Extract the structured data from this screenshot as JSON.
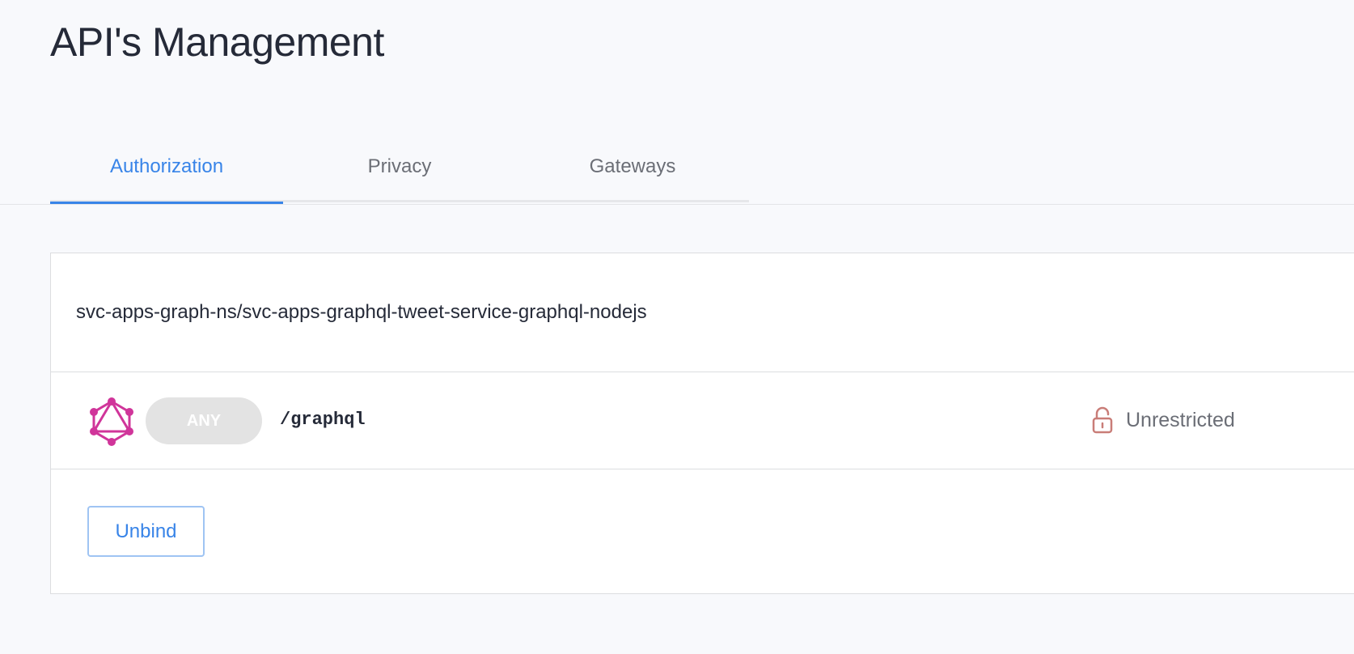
{
  "page": {
    "title": "API's Management"
  },
  "tabs": [
    {
      "label": "Authorization",
      "active": true
    },
    {
      "label": "Privacy",
      "active": false
    },
    {
      "label": "Gateways",
      "active": false
    }
  ],
  "service": {
    "name": "svc-apps-graph-ns/svc-apps-graphql-tweet-service-graphql-nodejs"
  },
  "route": {
    "icon": "graphql-icon",
    "method": "ANY",
    "path": "/graphql",
    "access_icon": "unlock-icon",
    "access_status": "Unrestricted"
  },
  "actions": {
    "unbind_label": "Unbind"
  },
  "colors": {
    "accent": "#3884e8",
    "graphql": "#d0359a",
    "lock": "#c97d78",
    "background": "#f8f9fc"
  }
}
